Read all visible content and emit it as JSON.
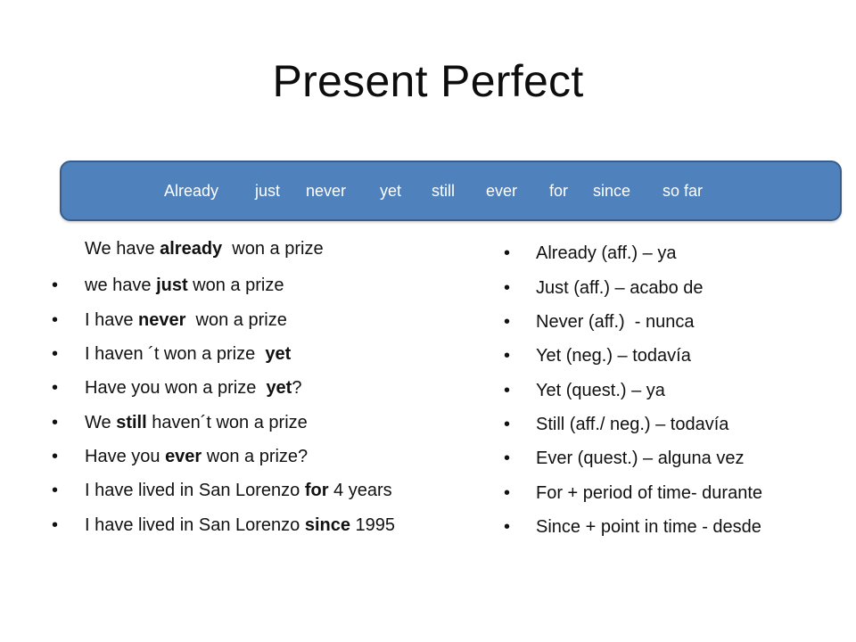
{
  "slide": {
    "title": "Present Perfect",
    "banner": {
      "color": "#4F81BD",
      "border_color": "#385D8A",
      "words": [
        "Already",
        "just",
        "never",
        "yet",
        "still",
        "ever",
        "for",
        "since",
        "so far"
      ]
    },
    "examples": {
      "header": {
        "parts": [
          {
            "text": "We have ",
            "bold": false
          },
          {
            "text": "already",
            "bold": true
          },
          {
            "text": "  won a prize",
            "bold": false
          }
        ]
      },
      "items": [
        {
          "parts": [
            {
              "text": "we have ",
              "bold": false
            },
            {
              "text": "just",
              "bold": true
            },
            {
              "text": " won a prize",
              "bold": false
            }
          ]
        },
        {
          "parts": [
            {
              "text": "I have ",
              "bold": false
            },
            {
              "text": "never",
              "bold": true
            },
            {
              "text": "  won a prize",
              "bold": false
            }
          ]
        },
        {
          "parts": [
            {
              "text": "I haven ´t won a prize  ",
              "bold": false
            },
            {
              "text": "yet",
              "bold": true
            }
          ]
        },
        {
          "parts": [
            {
              "text": "Have you won a prize  ",
              "bold": false
            },
            {
              "text": "yet",
              "bold": true
            },
            {
              "text": "?",
              "bold": false
            }
          ]
        },
        {
          "parts": [
            {
              "text": "We ",
              "bold": false
            },
            {
              "text": "still",
              "bold": true
            },
            {
              "text": " haven´t won a prize",
              "bold": false
            }
          ]
        },
        {
          "parts": [
            {
              "text": "Have you ",
              "bold": false
            },
            {
              "text": "ever",
              "bold": true
            },
            {
              "text": " won a prize?",
              "bold": false
            }
          ]
        },
        {
          "parts": [
            {
              "text": "I have lived in San Lorenzo ",
              "bold": false
            },
            {
              "text": "for",
              "bold": true
            },
            {
              "text": " 4 years",
              "bold": false
            }
          ]
        },
        {
          "parts": [
            {
              "text": "I have lived in San Lorenzo ",
              "bold": false
            },
            {
              "text": "since",
              "bold": true
            },
            {
              "text": " 1995",
              "bold": false
            }
          ]
        }
      ]
    },
    "translations": {
      "items": [
        "Already (aff.) – ya",
        "Just (aff.) – acabo de",
        "Never (aff.)  - nunca",
        "Yet (neg.) – todavía",
        "Yet (quest.) – ya",
        "Still (aff./ neg.) – todavía",
        "Ever (quest.) – alguna vez",
        "For + period of time- durante",
        "Since + point in time - desde"
      ]
    },
    "bullet_glyph": "•"
  }
}
